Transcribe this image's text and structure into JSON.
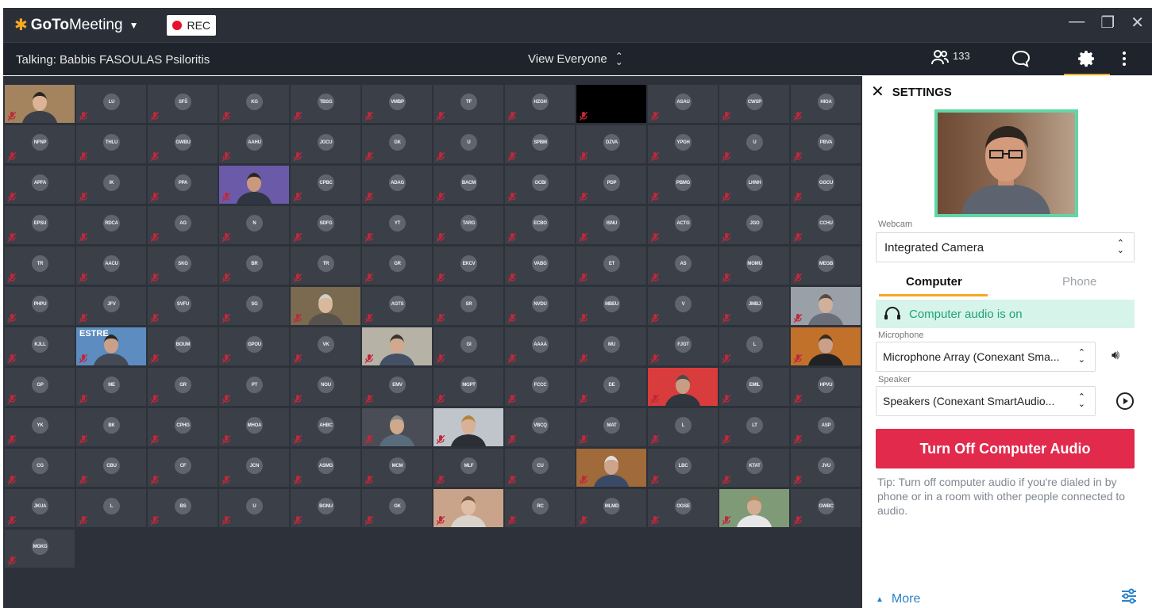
{
  "app": {
    "brand_bold": "GoTo",
    "brand_rest": "Meeting",
    "rec_label": "REC"
  },
  "statusbar": {
    "talking": "Talking: Babbis FASOULAS Psiloritis",
    "view_label": "View Everyone",
    "participant_count": "133"
  },
  "grid": {
    "rows": [
      [
        "@v1",
        "LU",
        "SFŠ",
        "KG",
        "TBSG",
        "VMBP",
        "TF",
        "HZGH",
        "@black",
        "ASAU",
        "CWSP",
        "HIOA"
      ],
      [
        "NFNP",
        "THLU",
        "GWBU",
        "AAHU",
        "JGCU",
        "GK",
        "U",
        "SPBM",
        "DZVA",
        "YPGH",
        "U",
        "PBVA"
      ],
      [
        "APFA",
        "IK",
        "PPA",
        "@v2",
        "CPBC",
        "ADAG",
        "BACM",
        "GCBI",
        "PDP",
        "PBMG",
        "LHNH",
        "GGCU"
      ],
      [
        "EPSU",
        "RDCA",
        "AG",
        "N",
        "SDFG",
        "YT",
        "TARG",
        "ECBO",
        "ISNU",
        "ACTG",
        "JGO",
        "CCHU"
      ],
      [
        "TR",
        "AACU",
        "SKG",
        "BR",
        "TR",
        "GR",
        "EKCV",
        "VABG",
        "ET",
        "AS",
        "MOMU",
        "MEGB"
      ],
      [
        "PHPU",
        "JFV",
        "SVFU",
        "SG",
        "@v3",
        "AGTS",
        "SR",
        "NVDU",
        "MBEU",
        "V",
        "JMBJ",
        "@v4"
      ],
      [
        "KJLL",
        "@v5",
        "BOUM",
        "GPOU",
        "VK",
        "@v6",
        "GI",
        "AAAA",
        "MU",
        "FJGT",
        "L",
        "@v7"
      ],
      [
        "GP",
        "ME",
        "GR",
        "PT",
        "NOU",
        "EMV",
        "MGPT",
        "FCCC",
        "DE",
        "@v8",
        "EMIL",
        "HPVU"
      ],
      [
        "YK",
        "BK",
        "CPHG",
        "MHOA",
        "AHBC",
        "@v9",
        "@v10",
        "VBCQ",
        "MAT",
        "L",
        "LT",
        "ASP"
      ],
      [
        "CG",
        "CBU",
        "CF",
        "JCN",
        "ASMG",
        "MCM",
        "MLF",
        "CU",
        "@v11",
        "LBC",
        "KTAT",
        "JVU"
      ],
      [
        "JKUA",
        "L",
        "BS",
        "U",
        "BGNU",
        "GK",
        "@v12",
        "RC",
        "MLMD",
        "OGSE",
        "@v13",
        "GWBC"
      ],
      [
        "MGKG"
      ]
    ],
    "video_tile_names": {
      "v5": "ESTRE"
    }
  },
  "settings": {
    "title": "SETTINGS",
    "webcam_label": "Webcam",
    "webcam_value": "Integrated Camera",
    "tab_computer": "Computer",
    "tab_phone": "Phone",
    "audio_status": "Computer audio is on",
    "microphone_label": "Microphone",
    "microphone_value": "Microphone Array (Conexant Sma...",
    "speaker_label": "Speaker",
    "speaker_value": "Speakers (Conexant SmartAudio...",
    "turn_off_label": "Turn Off Computer Audio",
    "tip": "Tip: Turn off computer audio if you're dialed in by phone or in a room with other people connected to audio.",
    "more_label": "More"
  },
  "colors": {
    "accent_orange": "#f7a823",
    "rec_red": "#e8112d",
    "turn_off_red": "#e12a4c",
    "audio_green": "#1fa377",
    "preview_border": "#5fd7a5",
    "mute_red": "#c0283a"
  },
  "icons": {
    "window": [
      "minimize-icon",
      "restore-icon",
      "close-icon"
    ],
    "statusbar": [
      "participants-icon",
      "chat-icon",
      "gear-icon",
      "more-vertical-icon"
    ]
  }
}
